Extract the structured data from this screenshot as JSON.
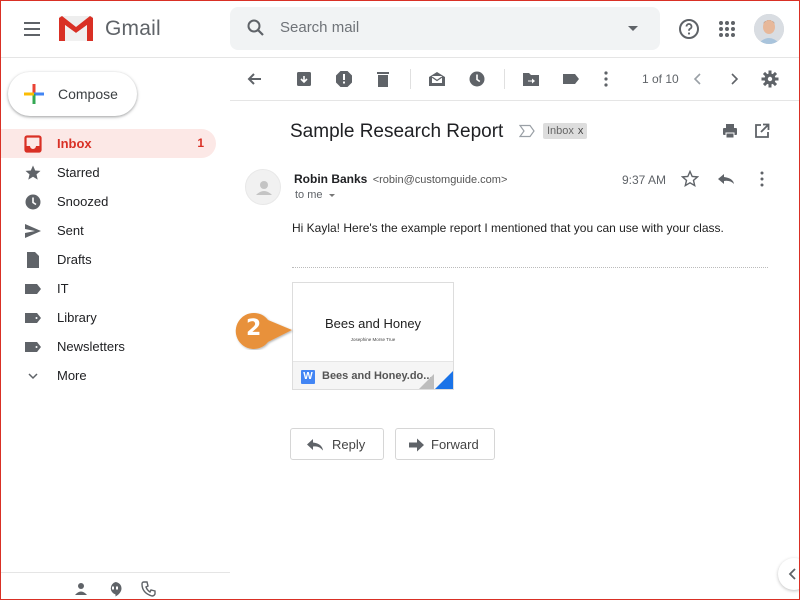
{
  "app": {
    "name": "Gmail"
  },
  "header": {
    "search_placeholder": "Search mail",
    "icons": [
      "menu-icon",
      "help-icon",
      "apps-icon",
      "account-avatar"
    ]
  },
  "sidebar": {
    "compose_label": "Compose",
    "items": [
      {
        "label": "Inbox",
        "icon": "inbox-icon",
        "count": "1",
        "active": true
      },
      {
        "label": "Starred",
        "icon": "star-icon"
      },
      {
        "label": "Snoozed",
        "icon": "clock-icon"
      },
      {
        "label": "Sent",
        "icon": "send-icon"
      },
      {
        "label": "Drafts",
        "icon": "draft-icon"
      },
      {
        "label": "IT",
        "icon": "label-icon"
      },
      {
        "label": "Library",
        "icon": "label-icon"
      },
      {
        "label": "Newsletters",
        "icon": "label-icon"
      },
      {
        "label": "More",
        "icon": "chevron-down-icon"
      }
    ],
    "footer_icons": [
      "contacts-icon",
      "hangouts-icon",
      "phone-icon"
    ]
  },
  "toolbar": {
    "pager": "1 of 10",
    "icons": [
      "back-icon",
      "archive-icon",
      "report-spam-icon",
      "delete-icon",
      "mark-unread-icon",
      "snooze-icon",
      "move-to-icon",
      "labels-icon",
      "more-icon",
      "prev-icon",
      "next-icon",
      "settings-icon"
    ]
  },
  "message": {
    "subject": "Sample Research Report",
    "label_chip": "Inbox",
    "label_chip_close": "x",
    "sender_name": "Robin Banks",
    "sender_email": "<robin@customguide.com>",
    "recipient": "to me",
    "time": "9:37 AM",
    "body": "Hi Kayla! Here's the example report I mentioned that you can use with your class.",
    "attachment": {
      "preview_title": "Bees and Honey",
      "preview_author": "Josephine Morse True",
      "file_name": "Bees and Honey.do...",
      "file_type_badge": "W"
    },
    "reply_label": "Reply",
    "forward_label": "Forward"
  },
  "callout": {
    "step": "2",
    "color": "#e8913a"
  },
  "colors": {
    "accent": "#d93025",
    "active_bg": "#fce8e6",
    "doc_blue": "#4285f4"
  }
}
